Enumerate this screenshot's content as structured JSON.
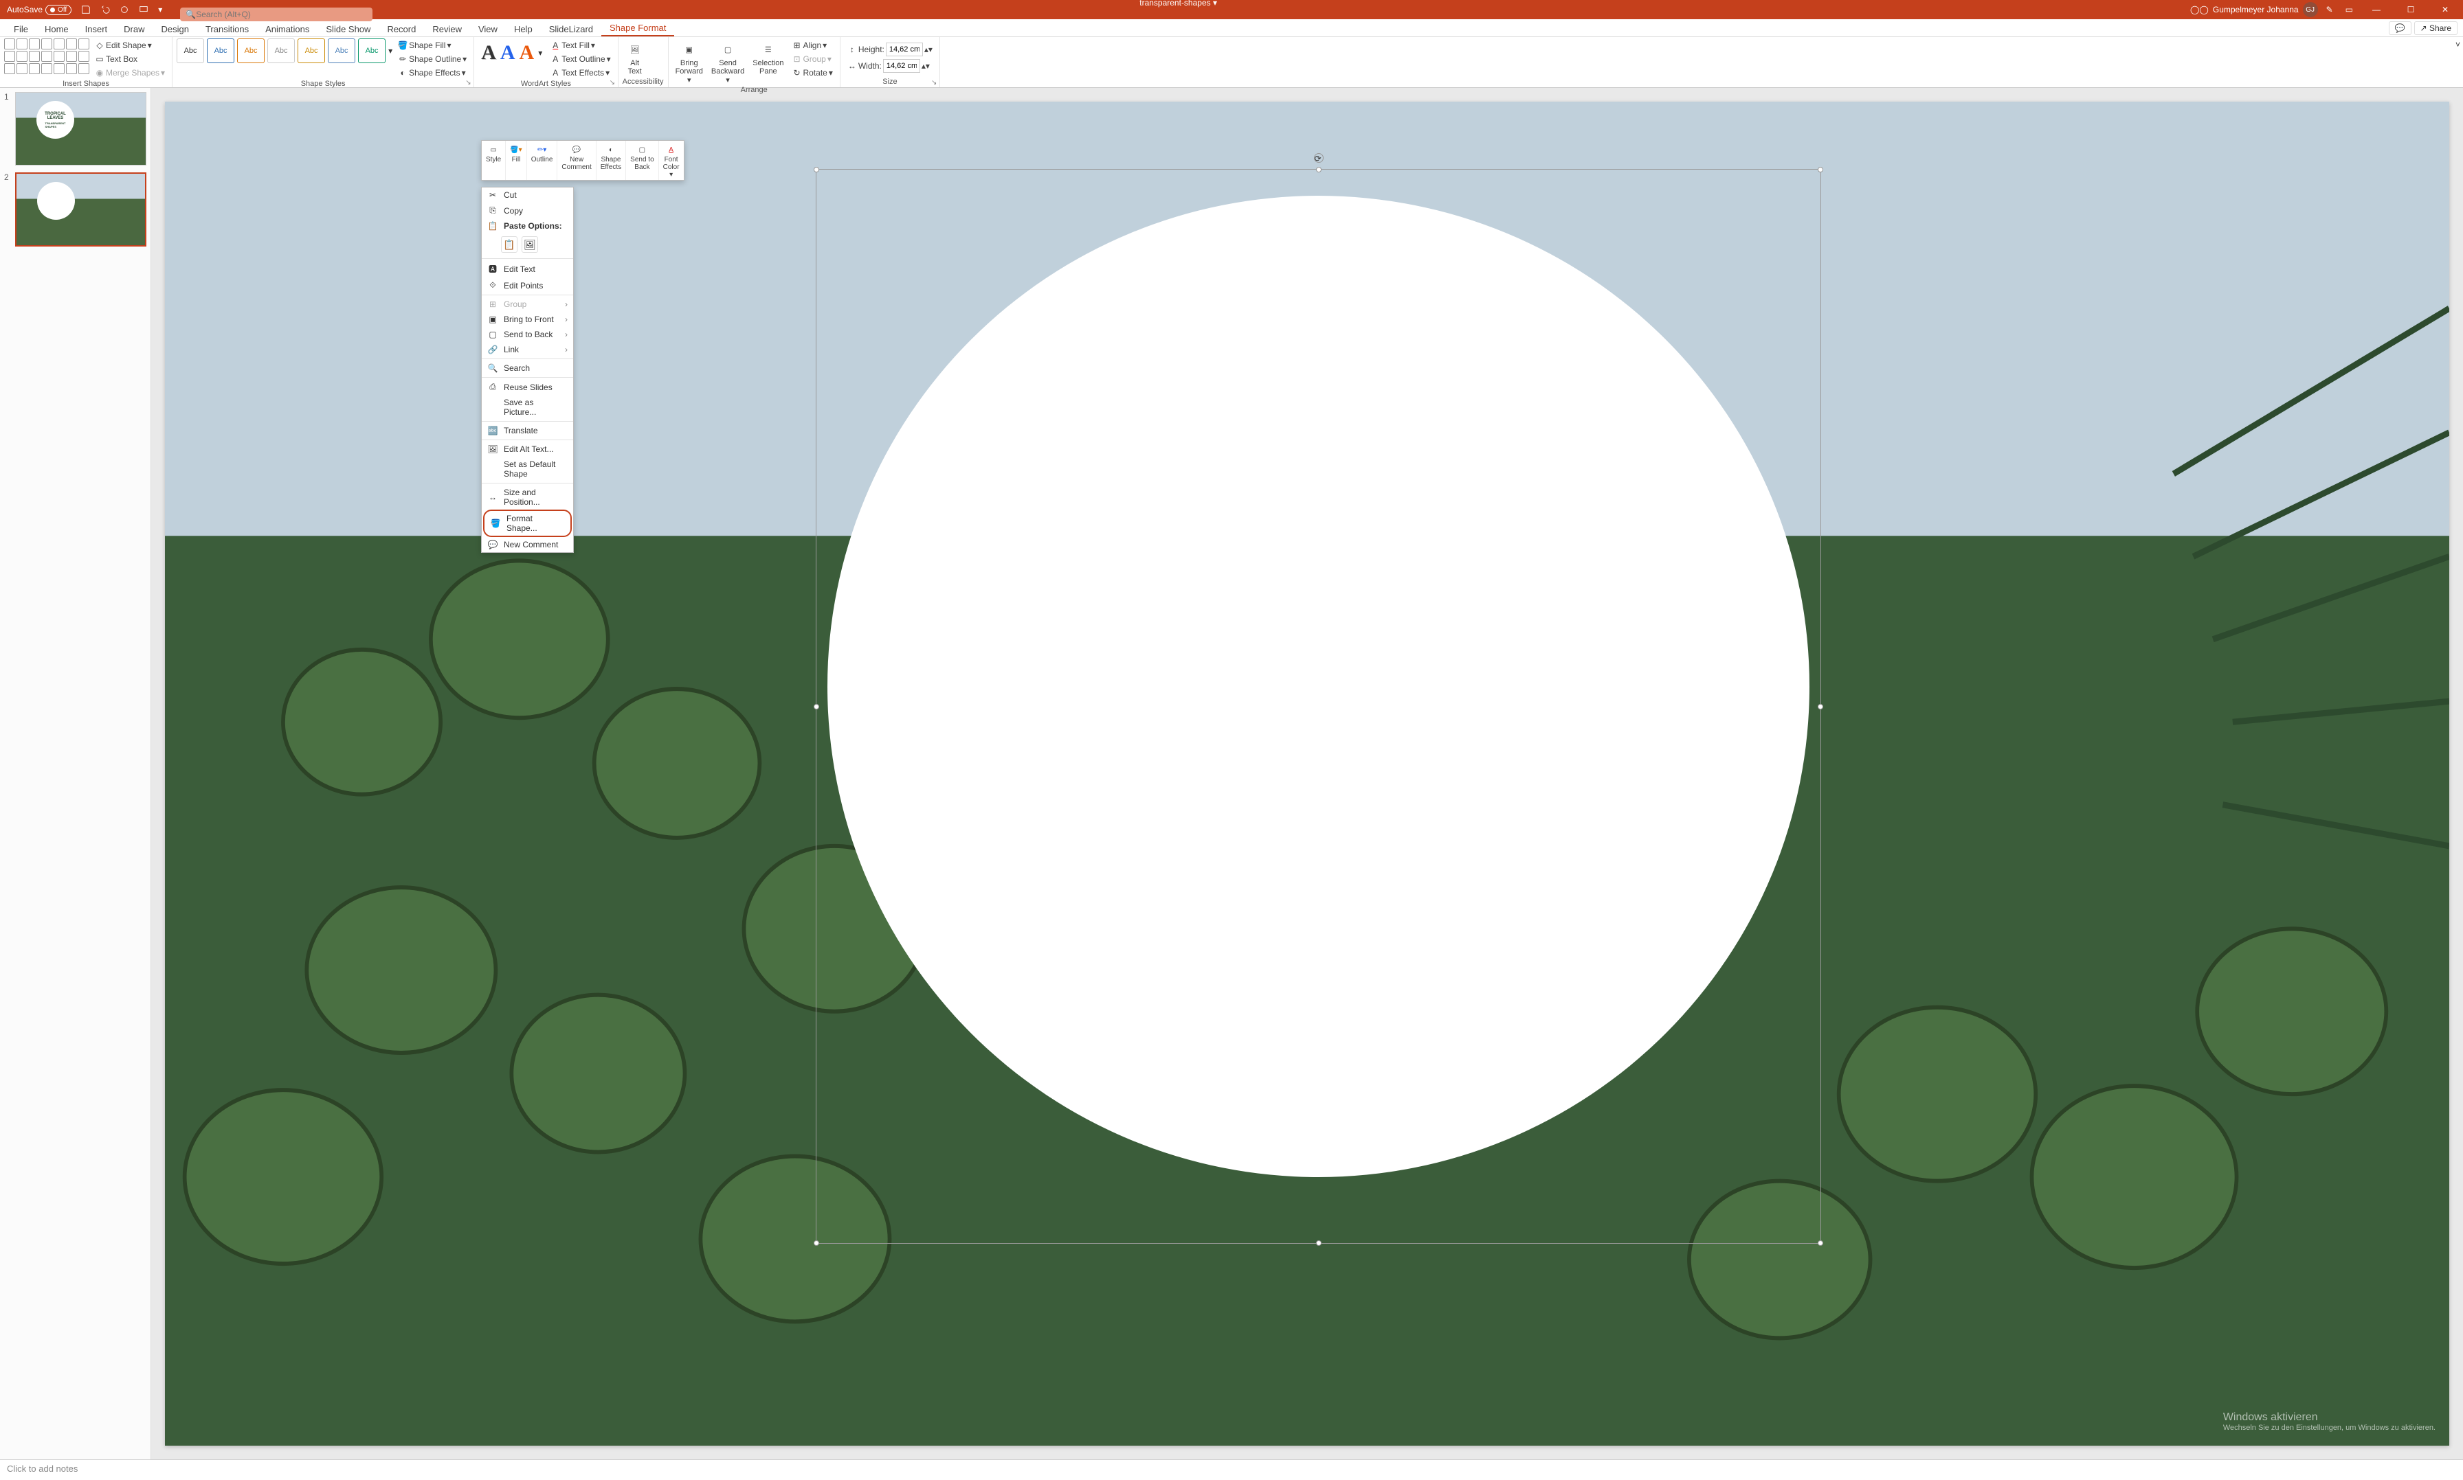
{
  "titlebar": {
    "autosave_label": "AutoSave",
    "autosave_state": "Off",
    "doc_title": "transparent-shapes",
    "search_placeholder": "Search (Alt+Q)",
    "user_name": "Gumpelmeyer Johanna",
    "user_initials": "GJ"
  },
  "menubar": {
    "tabs": [
      "File",
      "Home",
      "Insert",
      "Draw",
      "Design",
      "Transitions",
      "Animations",
      "Slide Show",
      "Record",
      "Review",
      "View",
      "Help",
      "SlideLizard",
      "Shape Format"
    ],
    "active_index": 13,
    "share_label": "Share"
  },
  "ribbon": {
    "insert_shapes": {
      "title": "Insert Shapes",
      "edit_shape": "Edit Shape",
      "text_box": "Text Box",
      "merge_shapes": "Merge Shapes"
    },
    "shape_styles": {
      "title": "Shape Styles",
      "shape_fill": "Shape Fill",
      "shape_outline": "Shape Outline",
      "shape_effects": "Shape Effects",
      "style_label": "Abc"
    },
    "wordart_styles": {
      "title": "WordArt Styles",
      "text_fill": "Text Fill",
      "text_outline": "Text Outline",
      "text_effects": "Text Effects"
    },
    "accessibility": {
      "title": "Accessibility",
      "alt_text": "Alt\nText"
    },
    "arrange": {
      "title": "Arrange",
      "bring_forward": "Bring\nForward",
      "send_backward": "Send\nBackward",
      "selection_pane": "Selection\nPane",
      "align": "Align",
      "group": "Group",
      "rotate": "Rotate"
    },
    "size": {
      "title": "Size",
      "height_label": "Height:",
      "height_value": "14,62 cm",
      "width_label": "Width:",
      "width_value": "14,62 cm"
    }
  },
  "mini_toolbar": {
    "style": "Style",
    "fill": "Fill",
    "outline": "Outline",
    "new_comment": "New\nComment",
    "shape_effects": "Shape\nEffects",
    "send_to_back": "Send to\nBack",
    "font_color": "Font\nColor"
  },
  "context_menu": {
    "cut": "Cut",
    "copy": "Copy",
    "paste_options": "Paste Options:",
    "edit_text": "Edit Text",
    "edit_points": "Edit Points",
    "group": "Group",
    "bring_to_front": "Bring to Front",
    "send_to_back": "Send to Back",
    "link": "Link",
    "search": "Search",
    "reuse_slides": "Reuse Slides",
    "save_as_picture": "Save as Picture...",
    "translate": "Translate",
    "edit_alt_text": "Edit Alt Text...",
    "set_as_default": "Set as Default Shape",
    "size_and_position": "Size and Position...",
    "format_shape": "Format Shape...",
    "new_comment": "New Comment"
  },
  "thumbs": {
    "slide1_title": "TROPICAL",
    "slide1_sub": "LEAVES",
    "slide1_tag": "TRANSPARENT\nSHAPES"
  },
  "notes_placeholder": "Click to add notes",
  "watermark": {
    "line1": "Windows aktivieren",
    "line2": "Wechseln Sie zu den Einstellungen, um Windows zu aktivieren."
  }
}
